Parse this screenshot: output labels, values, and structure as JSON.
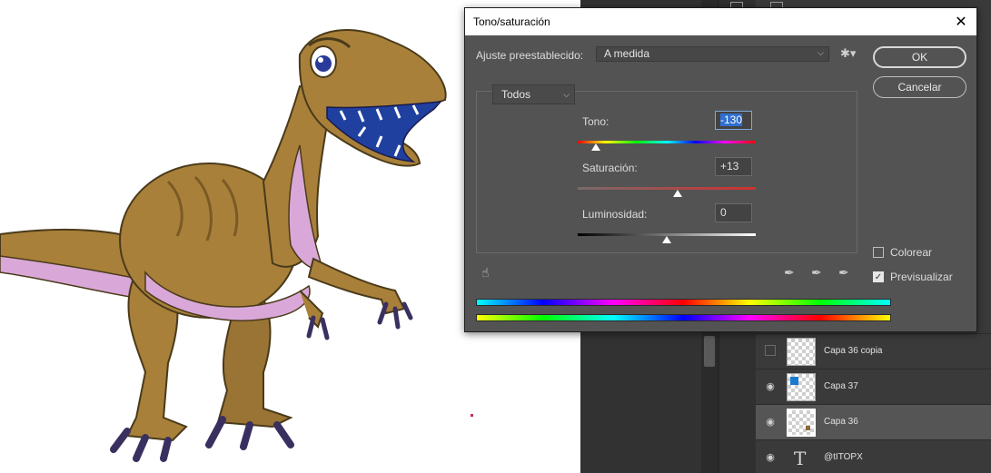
{
  "dialog": {
    "title": "Tono/saturación",
    "close_icon": "close-icon",
    "preset_label": "Ajuste preestablecido:",
    "preset_value": "A medida",
    "preset_options_icon": "gear-icon",
    "channel_value": "Todos",
    "hue": {
      "label": "Tono:",
      "value": "-130",
      "slider_fraction": 0.1
    },
    "saturation": {
      "label": "Saturación:",
      "value": "+13",
      "slider_fraction": 0.56
    },
    "lightness": {
      "label": "Luminosidad:",
      "value": "0",
      "slider_fraction": 0.5
    },
    "ok_label": "OK",
    "cancel_label": "Cancelar",
    "colorize_label": "Colorear",
    "colorize_checked": false,
    "preview_label": "Previsualizar",
    "preview_checked": true,
    "tools": [
      "target-adjust-icon",
      "eyedropper-icon",
      "eyedropper-add-icon",
      "eyedropper-subtract-icon"
    ]
  },
  "layers": [
    {
      "name": "Capa 36 copia",
      "visible": false,
      "selected": false
    },
    {
      "name": "Capa 37",
      "visible": true,
      "selected": false
    },
    {
      "name": "Capa 36",
      "visible": true,
      "selected": true
    },
    {
      "name": "@tITOPX",
      "visible": true,
      "selected": false,
      "type": "text"
    }
  ],
  "colors": {
    "dialog_bg": "#535353",
    "panel_bg": "#3a3a3a",
    "selected_row": "#555555",
    "dino_body": "#a8803a",
    "dino_belly": "#d9a8d8"
  }
}
